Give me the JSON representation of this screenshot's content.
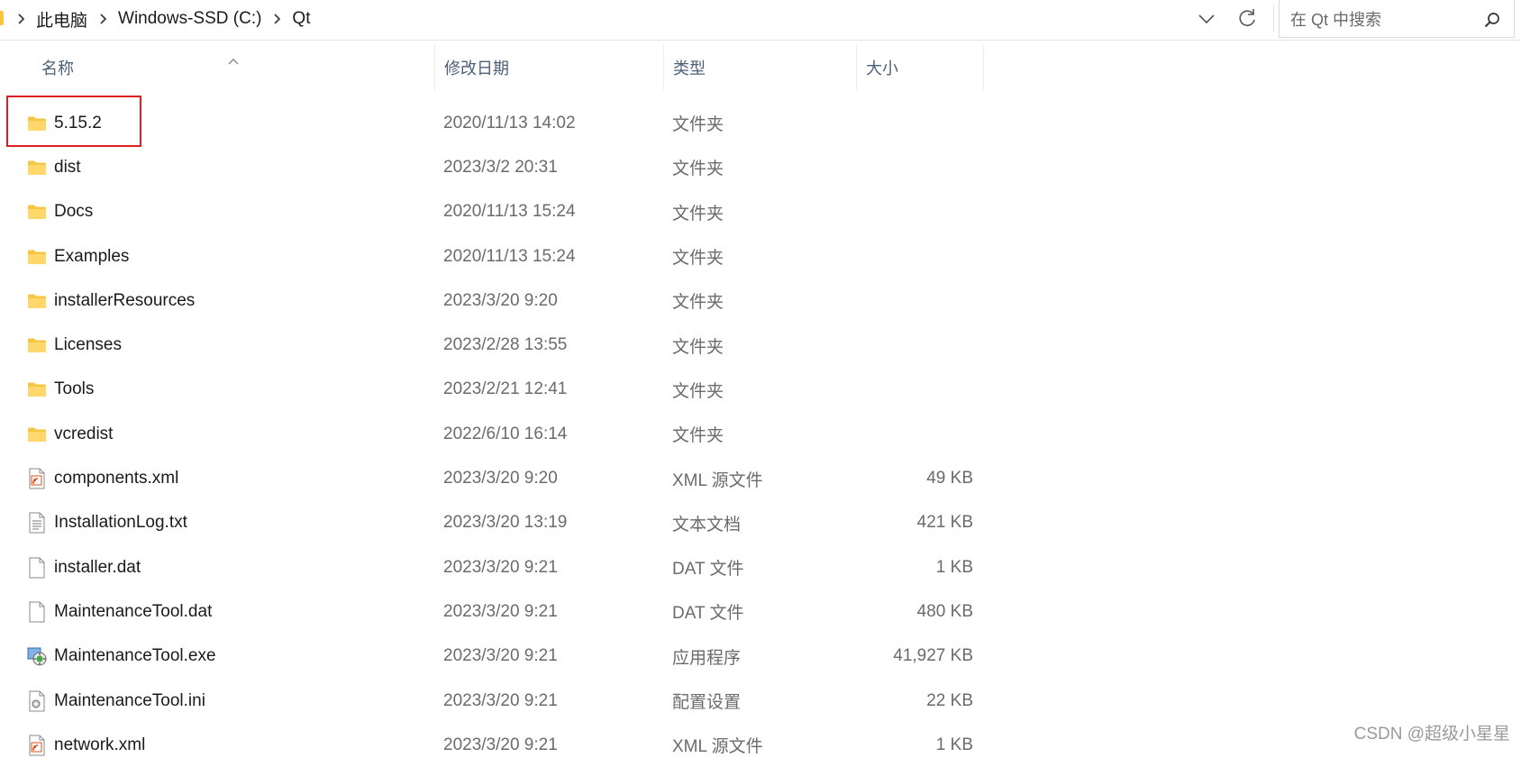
{
  "address_bar": {
    "breadcrumbs": [
      "此电脑",
      "Windows-SSD (C:)",
      "Qt"
    ]
  },
  "search": {
    "placeholder": "在 Qt 中搜索"
  },
  "columns": {
    "name": "名称",
    "date": "修改日期",
    "type": "类型",
    "size": "大小"
  },
  "files": [
    {
      "name": "5.15.2",
      "date": "2020/11/13 14:02",
      "type": "文件夹",
      "size": "",
      "icon": "folder-icon"
    },
    {
      "name": "dist",
      "date": "2023/3/2 20:31",
      "type": "文件夹",
      "size": "",
      "icon": "folder-icon"
    },
    {
      "name": "Docs",
      "date": "2020/11/13 15:24",
      "type": "文件夹",
      "size": "",
      "icon": "folder-icon"
    },
    {
      "name": "Examples",
      "date": "2020/11/13 15:24",
      "type": "文件夹",
      "size": "",
      "icon": "folder-icon"
    },
    {
      "name": "installerResources",
      "date": "2023/3/20 9:20",
      "type": "文件夹",
      "size": "",
      "icon": "folder-icon"
    },
    {
      "name": "Licenses",
      "date": "2023/2/28 13:55",
      "type": "文件夹",
      "size": "",
      "icon": "folder-icon"
    },
    {
      "name": "Tools",
      "date": "2023/2/21 12:41",
      "type": "文件夹",
      "size": "",
      "icon": "folder-icon"
    },
    {
      "name": "vcredist",
      "date": "2022/6/10 16:14",
      "type": "文件夹",
      "size": "",
      "icon": "folder-icon"
    },
    {
      "name": "components.xml",
      "date": "2023/3/20 9:20",
      "type": "XML 源文件",
      "size": "49 KB",
      "icon": "xml-file-icon"
    },
    {
      "name": "InstallationLog.txt",
      "date": "2023/3/20 13:19",
      "type": "文本文档",
      "size": "421 KB",
      "icon": "text-file-icon"
    },
    {
      "name": "installer.dat",
      "date": "2023/3/20 9:21",
      "type": "DAT 文件",
      "size": "1 KB",
      "icon": "blank-file-icon"
    },
    {
      "name": "MaintenanceTool.dat",
      "date": "2023/3/20 9:21",
      "type": "DAT 文件",
      "size": "480 KB",
      "icon": "blank-file-icon"
    },
    {
      "name": "MaintenanceTool.exe",
      "date": "2023/3/20 9:21",
      "type": "应用程序",
      "size": "41,927 KB",
      "icon": "exe-file-icon"
    },
    {
      "name": "MaintenanceTool.ini",
      "date": "2023/3/20 9:21",
      "type": "配置设置",
      "size": "22 KB",
      "icon": "ini-file-icon"
    },
    {
      "name": "network.xml",
      "date": "2023/3/20 9:21",
      "type": "XML 源文件",
      "size": "1 KB",
      "icon": "xml-file-icon"
    }
  ],
  "highlighted_item": "5.15.2",
  "watermark": "CSDN @超级小星星",
  "colors": {
    "folder": "#f6c640",
    "highlight_box": "#e02020",
    "header_text": "#4c607a",
    "secondary_text": "#6b6b6b"
  }
}
